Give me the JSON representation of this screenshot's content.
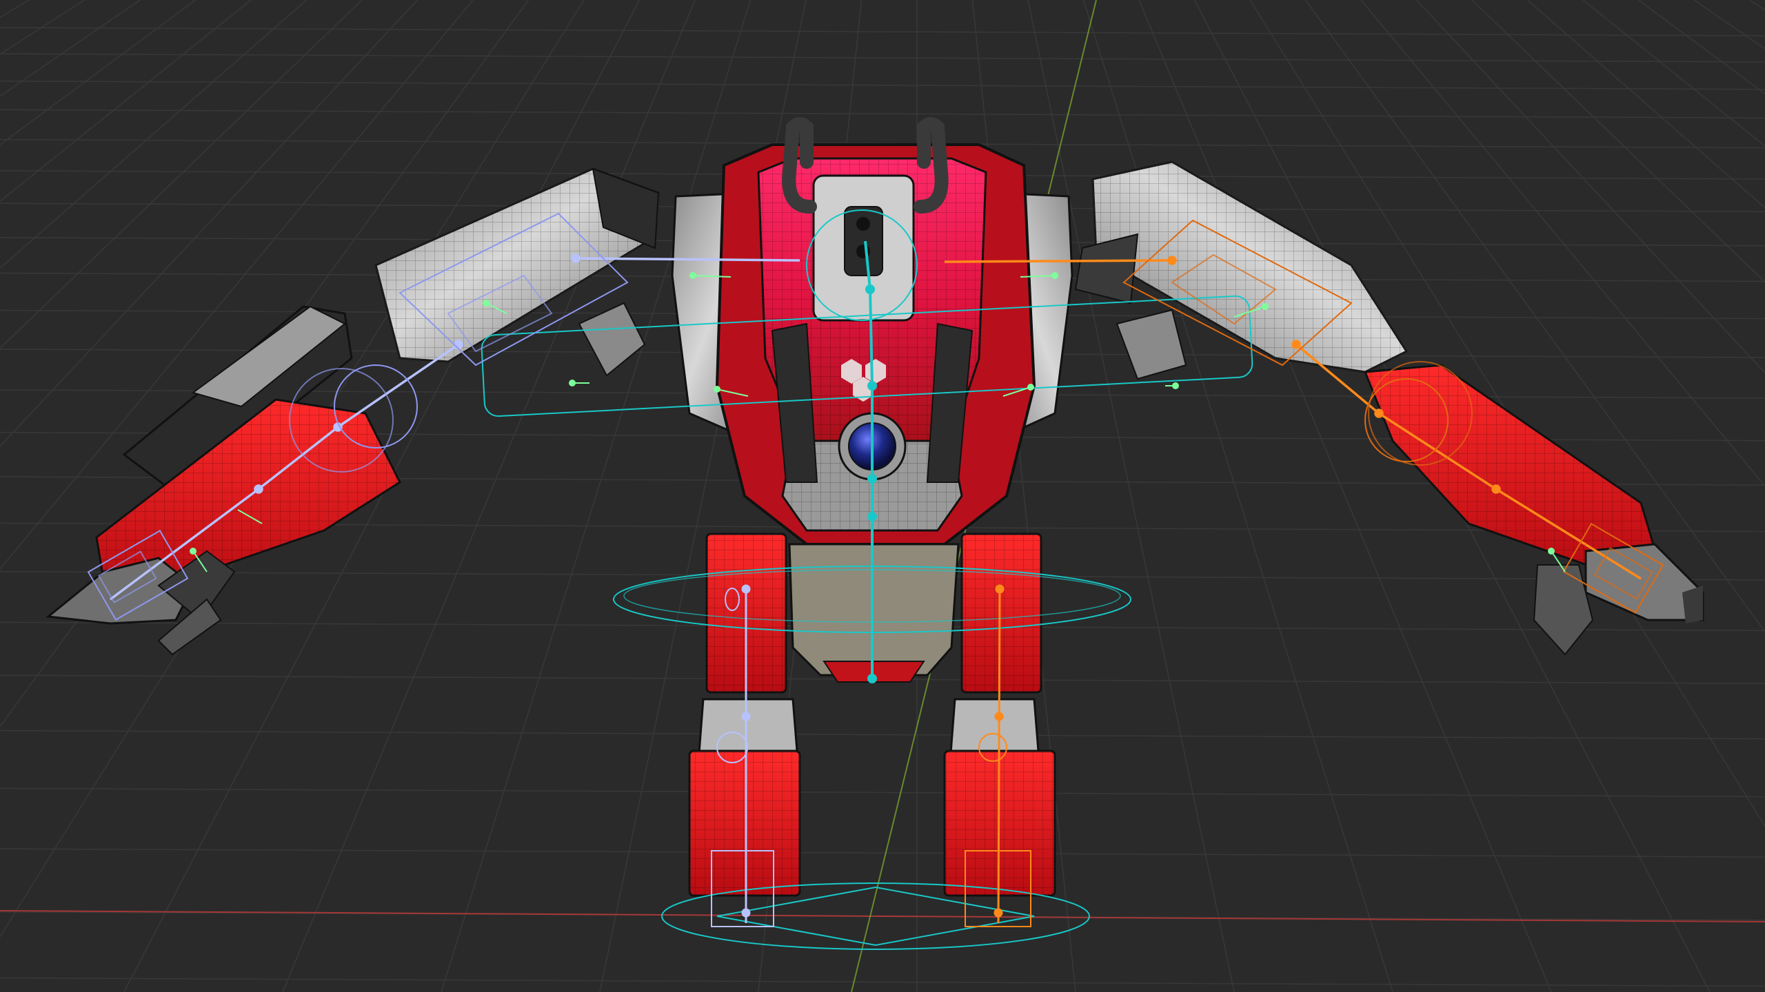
{
  "viewport": {
    "background_color": "#2a2a2a",
    "grid_color": "#383838",
    "x_axis_color": "#c23a3a",
    "y_axis_color": "#7fa832"
  },
  "model": {
    "body_red": "#e0141a",
    "body_red_dark": "#9b0a0e",
    "metal_light": "#c9c9c9",
    "metal_dark": "#4a4a4a",
    "wire_color": "#1a1a1a",
    "eye_color": "#1d2a8a"
  },
  "rig": {
    "center_bone_color": "#19c8c8",
    "left_side_color": "#b8c2ff",
    "right_side_color": "#ff8a1a",
    "ik_green": "#7dff9a"
  },
  "emblem_icon": "three-hexagon-logo-icon"
}
